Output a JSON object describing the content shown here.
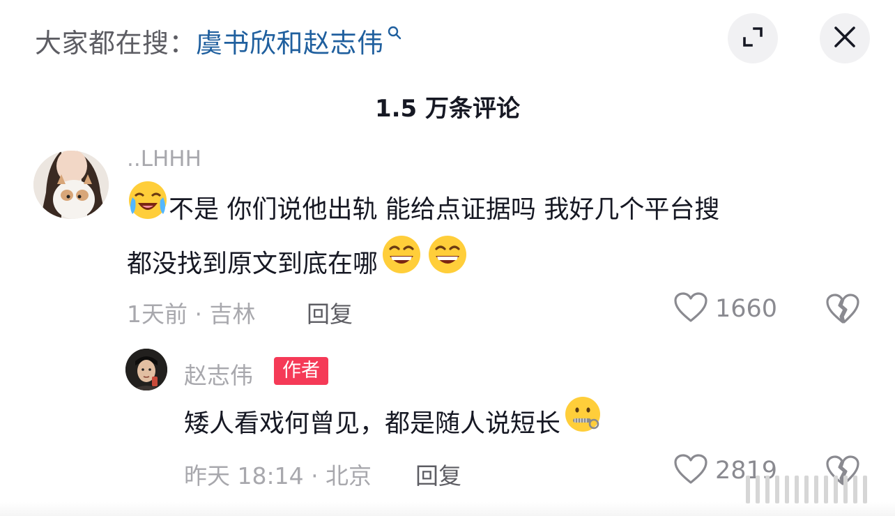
{
  "search": {
    "prefix": "大家都在搜：",
    "term": "虞书欣和赵志伟"
  },
  "header": {
    "comment_count": "1.5 万条评论"
  },
  "comments": [
    {
      "username": "..LHHH",
      "text_line1": "不是 你们说他出轨 能给点证据吗 我好几个平台搜",
      "text_line2": "都没找到原文到底在哪",
      "time_location": "1天前 · 吉林",
      "reply_label": "回复",
      "likes": "1660"
    },
    {
      "username": "赵志伟",
      "badge": "作者",
      "text": "矮人看戏何曾见，都是随人说短长",
      "time_location": "昨天 18:14 · 北京",
      "reply_label": "回复",
      "likes": "2819"
    }
  ],
  "icons": {
    "expand": "expand-icon",
    "close": "close-icon",
    "search": "search-icon",
    "like": "heart-outline-icon",
    "dislike": "broken-heart-icon",
    "emoji_cry": "crying-laugh-emoji",
    "emoji_grin": "grinning-emoji",
    "emoji_zipper": "zipper-mouth-emoji"
  },
  "colors": {
    "search_term": "#1f5f9e",
    "badge": "#f53a57",
    "primary_text": "#161823",
    "secondary_text": "#a8a8ad"
  }
}
